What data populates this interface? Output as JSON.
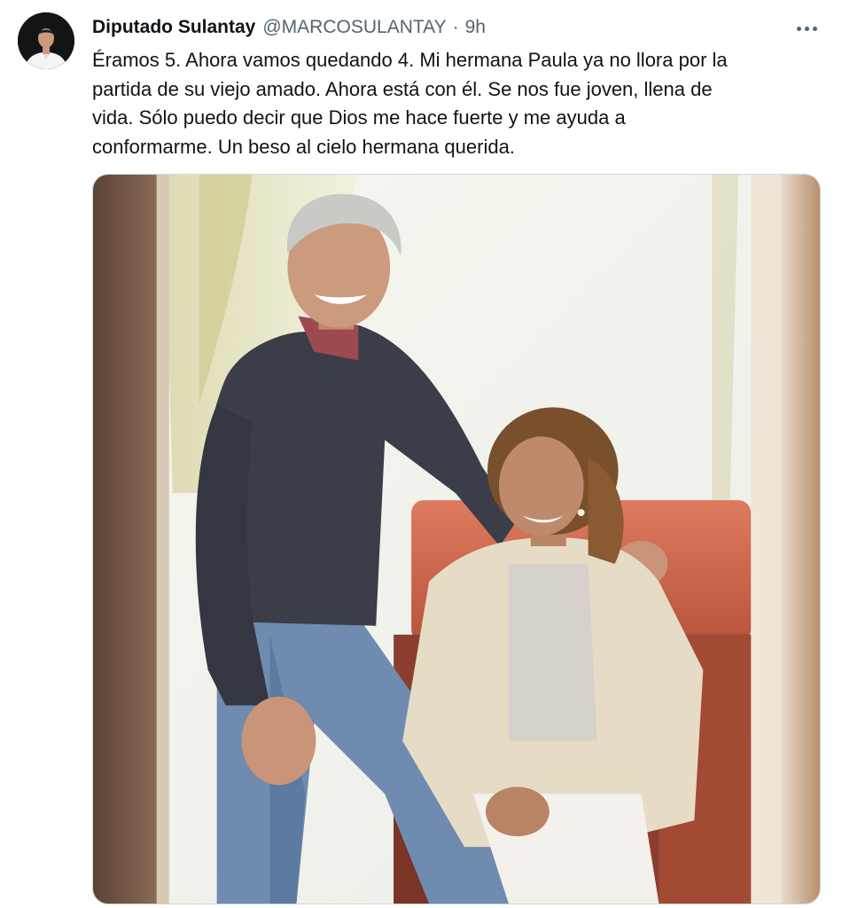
{
  "tweet": {
    "author": {
      "display_name": "Diputado Sulantay",
      "handle": "@MARCOSULANTAY",
      "separator": "·",
      "time": "9h",
      "avatar_icon": "profile-avatar"
    },
    "more_icon": "more-horizontal-icon",
    "text_lines": [
      "Éramos 5. Ahora vamos quedando 4. Mi hermana Paula ya no llora por la",
      "partida de su viejo amado. Ahora está con él. Se nos fue joven, llena de",
      "vida. Sólo puedo decir que Dios me hace fuerte y me ayuda a",
      "conformarme. Un beso al cielo hermana querida."
    ],
    "media": {
      "type": "photo",
      "colors": {
        "background": "#f2ede4",
        "sofa": "#d4694f",
        "sweater": "#3b3d48",
        "jeans": "#6f8bb0",
        "jacket": "#e6dcc6"
      }
    }
  }
}
